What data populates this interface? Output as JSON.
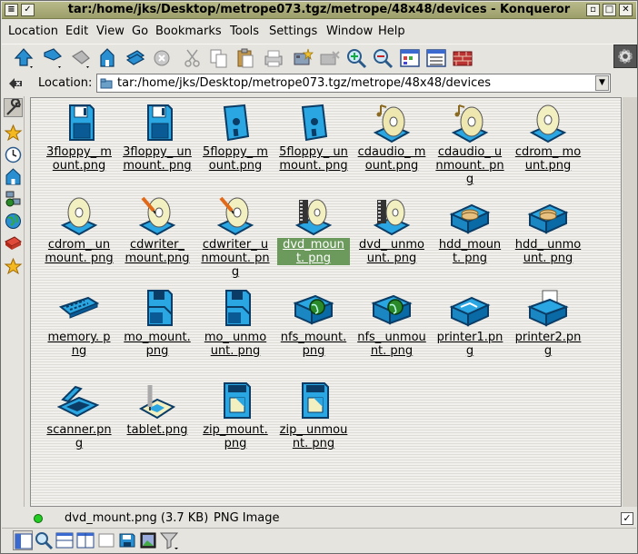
{
  "window": {
    "title": "tar:/home/jks/Desktop/metrope073.tgz/metrope/48x48/devices - Konqueror",
    "menu_glyph": "≡",
    "sticky_glyph": "✓",
    "minimize_glyph": "▫",
    "maximize_glyph": "□",
    "close_glyph": "✕"
  },
  "menubar": {
    "items": [
      "Location",
      "Edit",
      "View",
      "Go",
      "Bookmarks",
      "Tools",
      "Settings",
      "Window",
      "Help"
    ]
  },
  "location": {
    "label": "Location:",
    "value": "tar:/home/jks/Desktop/metrope073.tgz/metrope/48x48/devices",
    "dropdown_glyph": "▼"
  },
  "files": [
    {
      "name": "3floppy_ mount.png",
      "icon": "floppy-icon"
    },
    {
      "name": "3floppy_ unmount. png",
      "icon": "floppy-icon"
    },
    {
      "name": "5floppy_ mount.png",
      "icon": "floppy5-icon"
    },
    {
      "name": "5floppy_ unmount. png",
      "icon": "floppy5-icon"
    },
    {
      "name": "cdaudio_ mount.png",
      "icon": "cdaudio-icon"
    },
    {
      "name": "cdaudio_ unmount. png",
      "icon": "cdaudio-icon"
    },
    {
      "name": "cdrom_ mount.png",
      "icon": "cdrom-icon"
    },
    {
      "name": "cdrom_ unmount. png",
      "icon": "cdrom-icon"
    },
    {
      "name": "cdwriter_ mount.png",
      "icon": "cdwriter-icon"
    },
    {
      "name": "cdwriter_ unmount. png",
      "icon": "cdwriter-icon"
    },
    {
      "name": "dvd_mount. png",
      "icon": "dvd-icon",
      "selected": true
    },
    {
      "name": "dvd_ unmount. png",
      "icon": "dvd-icon"
    },
    {
      "name": "hdd_mount. png",
      "icon": "hdd-icon"
    },
    {
      "name": "hdd_ unmount. png",
      "icon": "hdd-icon"
    },
    {
      "name": "memory. png",
      "icon": "memory-icon"
    },
    {
      "name": "mo_mount. png",
      "icon": "mo-icon"
    },
    {
      "name": "mo_ unmount. png",
      "icon": "mo-icon"
    },
    {
      "name": "nfs_mount. png",
      "icon": "nfs-icon"
    },
    {
      "name": "nfs_ unmount. png",
      "icon": "nfs-icon"
    },
    {
      "name": "printer1.png",
      "icon": "printer-icon"
    },
    {
      "name": "printer2.png",
      "icon": "printer2-icon"
    },
    {
      "name": "scanner.png",
      "icon": "scanner-icon"
    },
    {
      "name": "tablet.png",
      "icon": "tablet-icon"
    },
    {
      "name": "zip_mount. png",
      "icon": "zip-icon"
    },
    {
      "name": "zip_ unmount. png",
      "icon": "zip-icon"
    }
  ],
  "status": {
    "filename": "dvd_mount.png (3.7 KB)",
    "type": "PNG Image",
    "check_glyph": "✓"
  },
  "colors": {
    "icon_blue": "#1f9bd8",
    "icon_dark": "#0a3c66",
    "selection": "#6b9a5c",
    "titlebar": "#a9ab7a"
  }
}
